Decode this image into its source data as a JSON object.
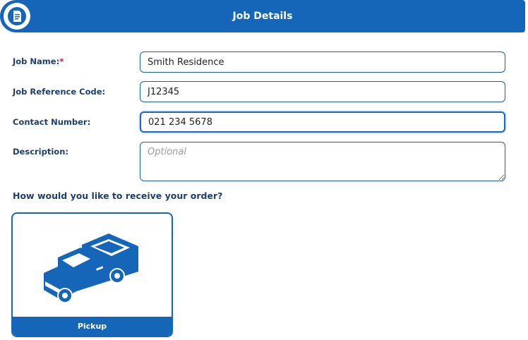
{
  "header": {
    "title": "Job Details",
    "icon": "document-icon"
  },
  "form": {
    "job_name": {
      "label": "Job Name:",
      "required_mark": "*",
      "value": "Smith Residence"
    },
    "job_reference": {
      "label": "Job Reference Code:",
      "value": "J12345"
    },
    "contact_number": {
      "label": "Contact Number:",
      "value": "021 234 5678"
    },
    "description": {
      "label": "Description:",
      "value": "",
      "placeholder": "Optional"
    }
  },
  "delivery": {
    "question": "How would you like to receive your order?",
    "options": [
      {
        "label": "Pickup",
        "icon": "pickup-truck-icon"
      }
    ]
  },
  "colors": {
    "primary": "#1565b8",
    "required": "#d11e1e",
    "label": "#1c3f6e"
  }
}
